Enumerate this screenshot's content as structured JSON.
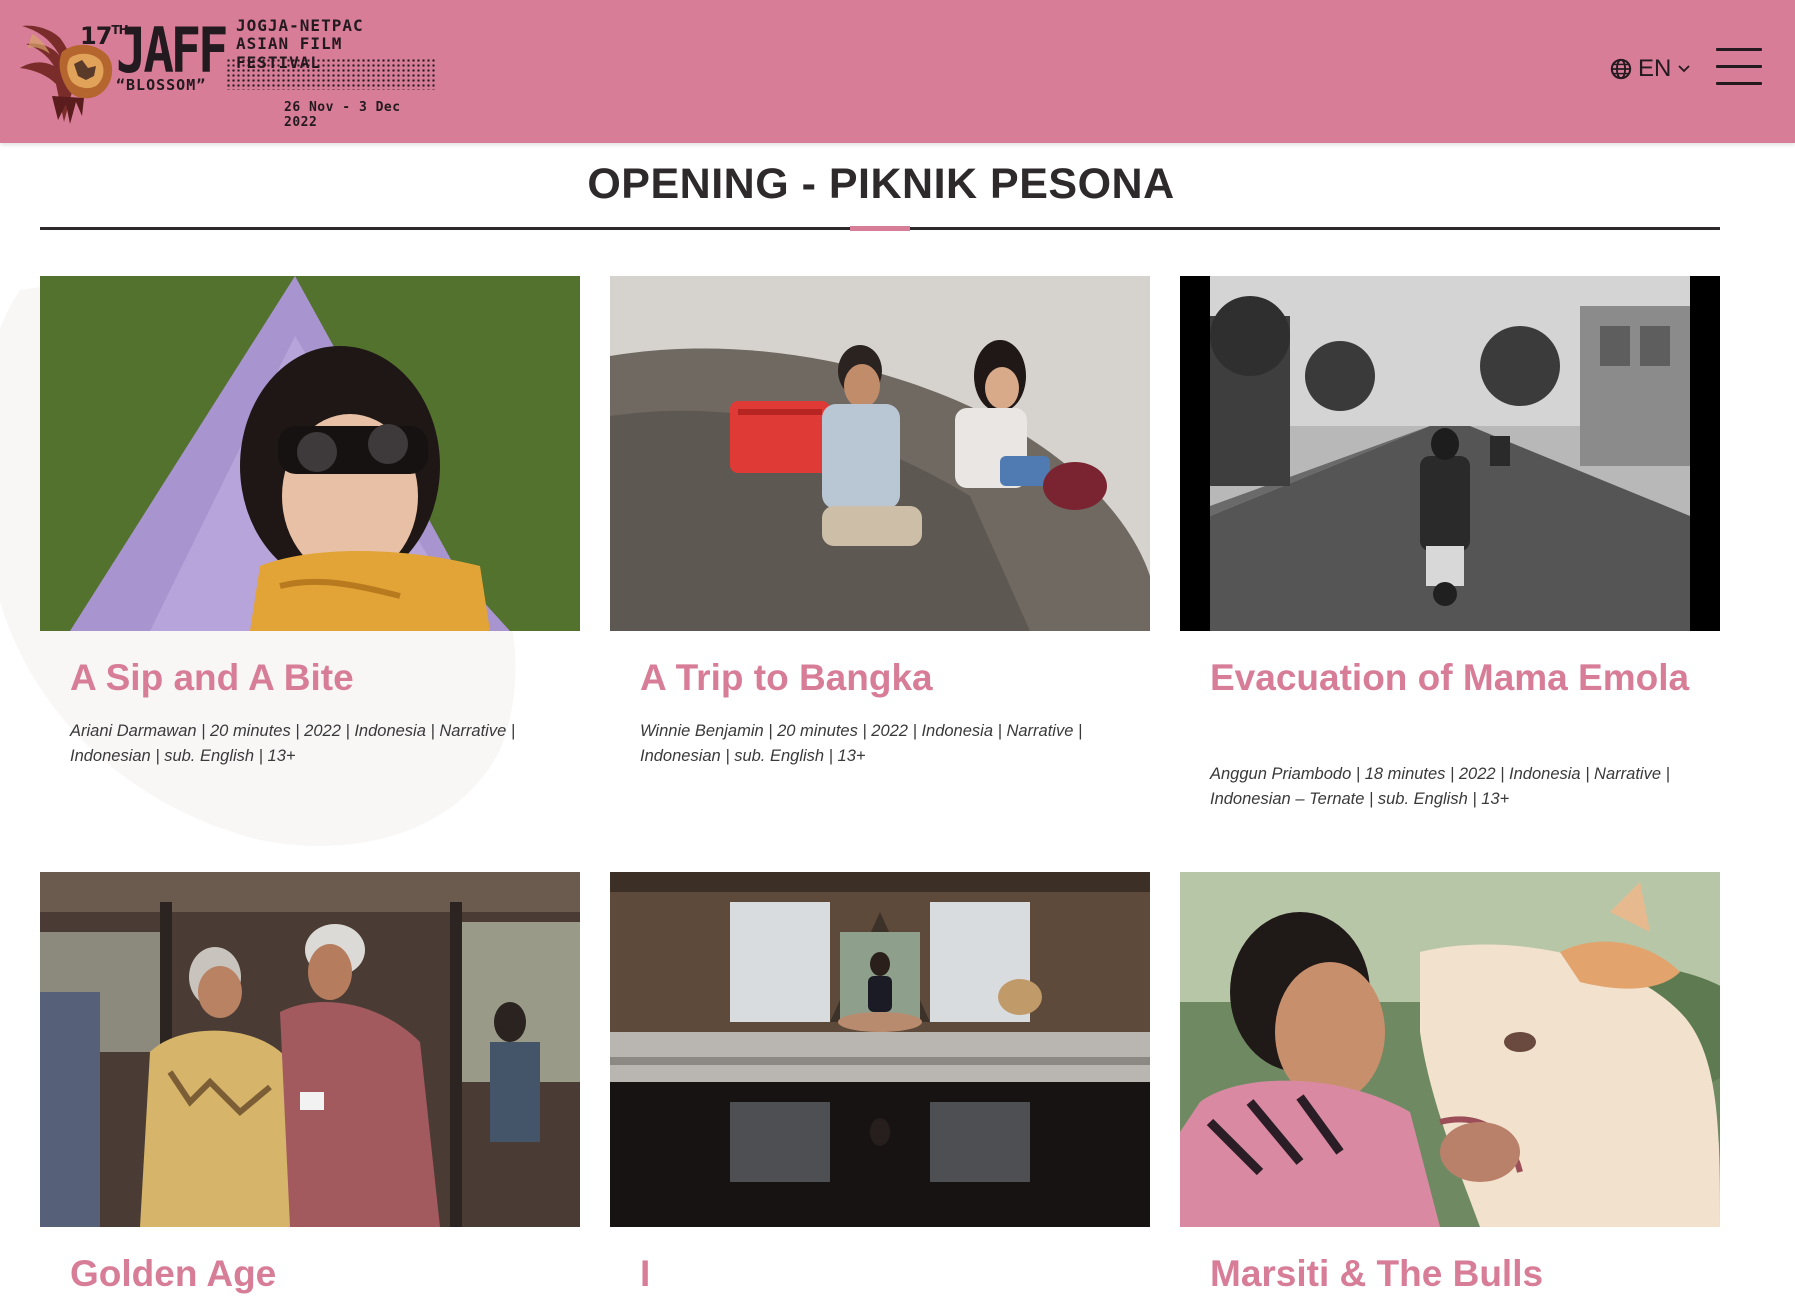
{
  "header": {
    "logo": {
      "edition": "17",
      "edition_suffix": "TH",
      "name": "JAFF",
      "line1": "JOGJA-NETPAC",
      "line2": "ASIAN FILM FESTIVAL",
      "theme": "“BLOSSOM”",
      "dates": "26 Nov - 3 Dec 2022"
    },
    "language": {
      "label": "EN",
      "icon": "globe-icon"
    },
    "menu_icon": "hamburger-menu-icon",
    "colors": {
      "background": "#d77d97",
      "text": "#231a1f"
    }
  },
  "page": {
    "title": "OPENING - PIKNIK PESONA",
    "accent_color": "#d77d97"
  },
  "films": [
    {
      "title": "A Sip and A Bite",
      "meta_line1": "Ariani Darmawan | 20 minutes | 2022 | Indonesia | Narrative |",
      "meta_line2": "Indonesian | sub. English | 13+"
    },
    {
      "title": "A Trip to Bangka",
      "meta_line1": "Winnie Benjamin | 20 minutes | 2022 | Indonesia | Narrative |",
      "meta_line2": "Indonesian | sub. English | 13+"
    },
    {
      "title": "Evacuation of Mama Emola",
      "meta_line1": "Anggun Priambodo | 18 minutes | 2022 | Indonesia | Narrative |",
      "meta_line2": "Indonesian – Ternate | sub. English | 13+"
    },
    {
      "title": "Golden Age"
    },
    {
      "title": "I"
    },
    {
      "title": "Marsiti & The Bulls"
    }
  ]
}
